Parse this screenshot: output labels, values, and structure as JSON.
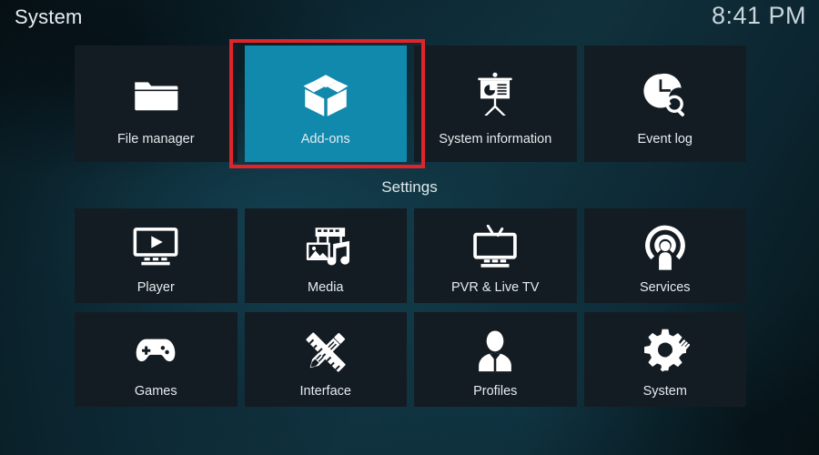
{
  "header": {
    "title": "System",
    "clock": "8:41 PM"
  },
  "sections": {
    "settings_label": "Settings"
  },
  "colors": {
    "selected_tile": "#1189ad",
    "tile": "#141c23",
    "annotation": "#e0242c",
    "text": "#e4ecef"
  },
  "top_row": [
    {
      "label": "File manager",
      "icon": "folder-icon",
      "selected": false
    },
    {
      "label": "Add-ons",
      "icon": "open-box-icon",
      "selected": true
    },
    {
      "label": "System information",
      "icon": "presentation-icon",
      "selected": false
    },
    {
      "label": "Event log",
      "icon": "clock-search-icon",
      "selected": false
    }
  ],
  "settings_rows": [
    [
      {
        "label": "Player",
        "icon": "monitor-play-icon",
        "selected": false
      },
      {
        "label": "Media",
        "icon": "media-stack-icon",
        "selected": false
      },
      {
        "label": "PVR & Live TV",
        "icon": "tv-antenna-icon",
        "selected": false
      },
      {
        "label": "Services",
        "icon": "broadcast-user-icon",
        "selected": false
      }
    ],
    [
      {
        "label": "Games",
        "icon": "gamepad-icon",
        "selected": false
      },
      {
        "label": "Interface",
        "icon": "pencil-ruler-icon",
        "selected": false
      },
      {
        "label": "Profiles",
        "icon": "user-bust-icon",
        "selected": false
      },
      {
        "label": "System",
        "icon": "gear-wrench-icon",
        "selected": false
      }
    ]
  ],
  "annotation": {
    "target": "Add-ons",
    "shape": "rectangle"
  }
}
